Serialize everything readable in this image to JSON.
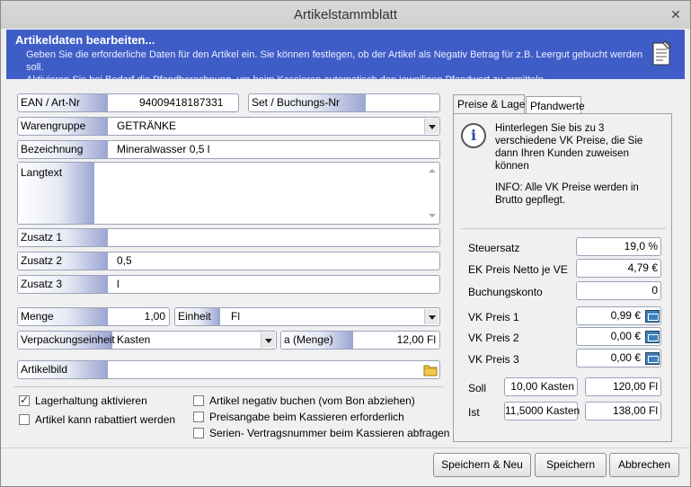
{
  "window": {
    "title": "Artikelstammblatt",
    "close_glyph": "✕"
  },
  "banner": {
    "heading": "Artikeldaten bearbeiten...",
    "line1": "Geben Sie die erforderliche Daten für den Artikel ein. Sie können festlegen, ob der Artikel als Negativ Betrag für z.B. Leergut gebucht werden soll.",
    "line2": "Aktivieren Sie bei Bedarf die Pfandberechnung, um beim Kassieren automatisch den jeweiligen Pfandwert zu ermitteln."
  },
  "form": {
    "ean": {
      "label": "EAN / Art-Nr",
      "value": "94009418187331"
    },
    "set": {
      "label": "Set / Buchungs-Nr",
      "value": ""
    },
    "warengruppe": {
      "label": "Warengruppe",
      "value": "GETRÄNKE"
    },
    "bezeichnung": {
      "label": "Bezeichnung",
      "value": "Mineralwasser 0,5 l"
    },
    "langtext": {
      "label": "Langtext",
      "value": ""
    },
    "zusatz1": {
      "label": "Zusatz 1",
      "value": ""
    },
    "zusatz2": {
      "label": "Zusatz 2",
      "value": "0,5"
    },
    "zusatz3": {
      "label": "Zusatz 3",
      "value": "l"
    },
    "menge": {
      "label": "Menge",
      "value": "1,00"
    },
    "einheit": {
      "label": "Einheit",
      "value": "Fl"
    },
    "verpackung": {
      "label": "Verpackungseinheit",
      "value": "Kasten"
    },
    "amenge": {
      "label": "a (Menge)",
      "value": "12,00 Fl"
    },
    "artikelbild": {
      "label": "Artikelbild",
      "value": ""
    }
  },
  "checkboxes": [
    {
      "label": "Lagerhaltung aktivieren",
      "checked": true
    },
    {
      "label": "Artikel kann rabattiert werden",
      "checked": false
    },
    {
      "label": "Artikel negativ buchen (vom Bon abziehen)",
      "checked": false
    },
    {
      "label": "Preisangabe beim Kassieren erforderlich",
      "checked": false
    },
    {
      "label": "Serien- Vertragsnummer beim Kassieren abfragen",
      "checked": false
    }
  ],
  "tabs": [
    {
      "label": "Preise & Lager",
      "active": true
    },
    {
      "label": "Pfandwerte",
      "active": false
    }
  ],
  "prices": {
    "hint": "Hinterlegen Sie bis zu 3 verschiedene VK Preise, die Sie dann Ihren Kunden zuweisen können",
    "info": "INFO: Alle VK Preise werden in Brutto gepflegt.",
    "steuersatz": {
      "label": "Steuersatz",
      "value": "19,0 %"
    },
    "ek": {
      "label": "EK Preis Netto je VE",
      "value": "4,79 €"
    },
    "buchungskonto": {
      "label": "Buchungskonto",
      "value": "0"
    },
    "vk1": {
      "label": "VK Preis 1",
      "value": "0,99 €"
    },
    "vk2": {
      "label": "VK Preis 2",
      "value": "0,00 €"
    },
    "vk3": {
      "label": "VK Preis 3",
      "value": "0,00 €"
    },
    "soll": {
      "label": "Soll",
      "kasten": "10,00 Kasten",
      "fl": "120,00 Fl"
    },
    "ist": {
      "label": "Ist",
      "kasten": "11,5000 Kasten",
      "fl": "138,00 Fl"
    }
  },
  "buttons": {
    "save_new": "Speichern & Neu",
    "save": "Speichern",
    "cancel": "Abbrechen"
  }
}
